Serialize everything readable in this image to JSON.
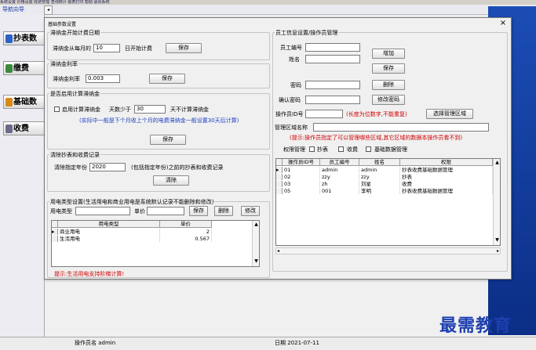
{
  "app": {
    "menu": "系统设置  价格设置  收费管理  查询统计  报表打印  帮助  退出系统",
    "nav_title": "导航向导",
    "collapse": "◂",
    "nav_items": [
      "抄表数",
      "缴费",
      "基础数",
      "收费"
    ],
    "status_operator": "操作员名 admin",
    "status_date": "日期 2021-07-11",
    "watermark": "最需教育"
  },
  "dialog": {
    "title": "基础参数设置",
    "close": "×",
    "g1": {
      "legend": "滞纳金开始计费日期",
      "label_pre": "滞纳金从每月的",
      "value": "10",
      "label_post": "日开始计费",
      "save": "保存"
    },
    "g2": {
      "legend": "滞纳金利率",
      "label": "滞纳金利率",
      "value": "0.003",
      "save": "保存"
    },
    "g3": {
      "legend": "是否启用计算滞纳金",
      "checkbox": "启用计算滞纳金",
      "days_pre": "天数少于",
      "days": "30",
      "days_post": "天不计算滞纳金",
      "hint": "(实际中一般是下个月收上个月的电费滞纳金一般设置30天后计算)",
      "save": "保存"
    },
    "g4": {
      "legend": "清除抄表和收费记录",
      "label": "清除指定年份",
      "value": "2020",
      "note": "(包括指定年份)之前的抄表和收费记录",
      "clear": "清除"
    },
    "g5": {
      "legend": "用电类型设置(生活用电和商业用电是系统默认记录不能删除和修改)",
      "type_label": "用电类型",
      "price_label": "单价",
      "save": "保存",
      "delete": "删除",
      "modify": "修改",
      "columns": [
        "用电类型",
        "单价"
      ],
      "rows": [
        {
          "type": "商业用电",
          "price": "2"
        },
        {
          "type": "生活用电",
          "price": "0.567"
        }
      ],
      "tip": "提示:生活用电支持阶梯计算!"
    },
    "g6": {
      "legend": "员工信息设置/操作员管理",
      "emp_id": "员工编号",
      "name": "姓名",
      "password": "密码",
      "confirm": "确认密码",
      "op_id": "操作员ID号",
      "op_id_hint": "(长度为位数字,不能重复)",
      "area_name": "管理区域名称",
      "area_hint": "(提示:操作员指定了可以管理哪些区域,其它区域的数据本操作员看不到)",
      "perm_label": "权限管理",
      "perm_meter": "抄表",
      "perm_charge": "收费",
      "perm_base": "基础数据管理",
      "btn_add": "增加",
      "btn_save": "保存",
      "btn_delete": "删除",
      "btn_changepwd": "修改密码",
      "btn_area": "选择管理区域",
      "columns": [
        "操作员ID号",
        "员工编号",
        "姓名",
        "权限"
      ],
      "rows": [
        {
          "op": "01",
          "emp": "admin",
          "name": "admin",
          "perm": "抄表收费基础数据管理"
        },
        {
          "op": "02",
          "emp": "zzy",
          "name": "zzy",
          "perm": "抄表"
        },
        {
          "op": "03",
          "emp": "zh",
          "name": "刘星",
          "perm": "收费"
        },
        {
          "op": "05",
          "emp": "001",
          "name": "李明",
          "perm": "抄表收费基础数据管理"
        }
      ]
    }
  }
}
